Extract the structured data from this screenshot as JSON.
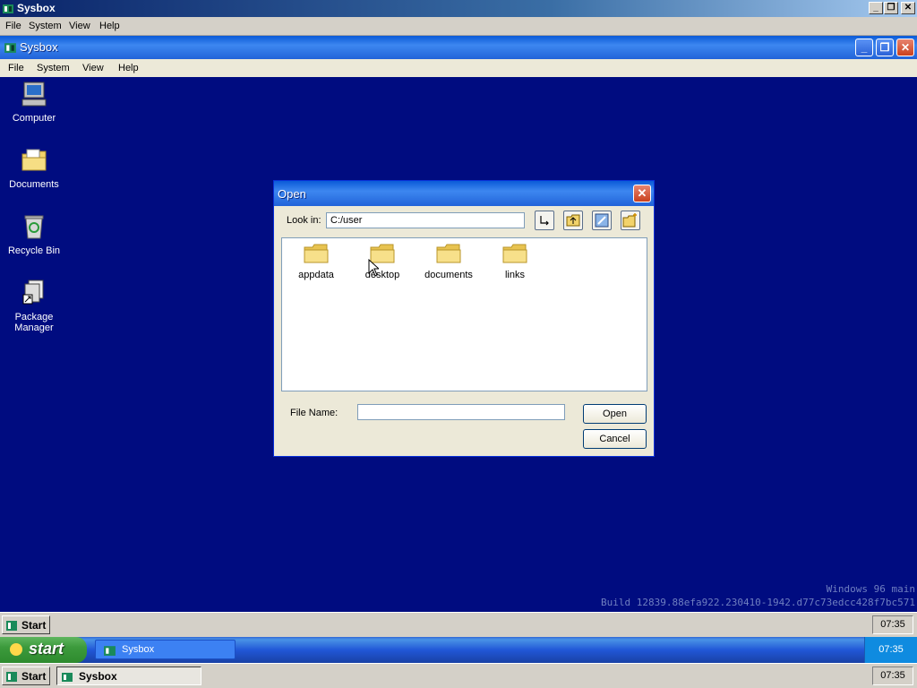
{
  "outer_window": {
    "title": "Sysbox",
    "icon": "sysbox-icon",
    "controls": [
      "minimize",
      "restore",
      "close"
    ],
    "menu": [
      "File",
      "System",
      "View",
      "Help"
    ]
  },
  "inner_window": {
    "title": "Sysbox",
    "icon": "sysbox-icon",
    "controls": [
      "minimize",
      "restore",
      "close"
    ],
    "menu": [
      "File",
      "System",
      "View",
      "Help"
    ]
  },
  "desktop_icons": [
    {
      "label": "Computer",
      "icon": "computer-icon"
    },
    {
      "label": "Documents",
      "icon": "documents-folder-icon"
    },
    {
      "label": "Recycle Bin",
      "icon": "recycle-bin-icon"
    },
    {
      "label": "Package Manager",
      "icon": "package-manager-icon"
    }
  ],
  "dialog": {
    "title": "Open",
    "look_in_label": "Look in:",
    "look_in_value": "C:/user",
    "toolbar_icons": [
      "go-icon",
      "up-folder-icon",
      "edit-icon",
      "new-folder-icon"
    ],
    "files": [
      {
        "name": "appdata",
        "icon": "folder-icon"
      },
      {
        "name": "desktop",
        "icon": "folder-icon"
      },
      {
        "name": "documents",
        "icon": "folder-icon"
      },
      {
        "name": "links",
        "icon": "folder-icon"
      }
    ],
    "file_name_label": "File Name:",
    "file_name_value": "",
    "open_label": "Open",
    "cancel_label": "Cancel"
  },
  "watermark": {
    "line1": "Windows 96 main",
    "line2": "Build 12839.88efa922.230410-1942.d77c73edcc428f7bc571"
  },
  "taskbar_classic_1": {
    "start_label": "Start",
    "clock": "07:35"
  },
  "taskbar_xp": {
    "start_label": "start",
    "task_label": "Sysbox",
    "clock": "07:35"
  },
  "taskbar_classic_2": {
    "start_label": "Start",
    "task_label": "Sysbox",
    "clock": "07:35"
  },
  "colors": {
    "desktop": "#000c80",
    "xp_blue": "#2163d9",
    "xp_green": "#3c9a3c"
  }
}
